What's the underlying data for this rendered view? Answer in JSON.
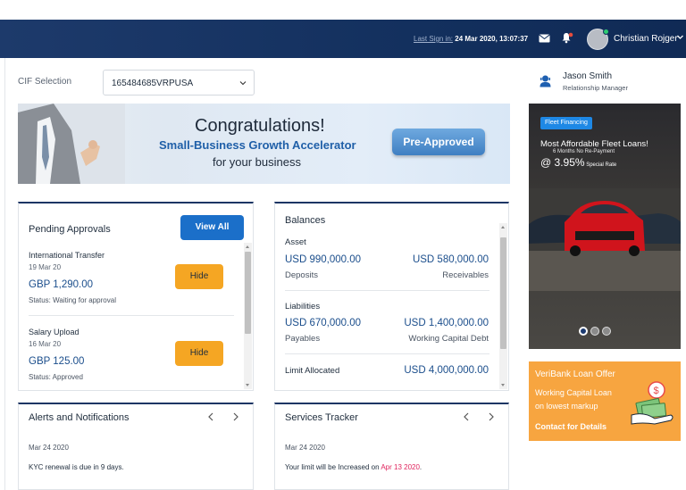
{
  "header": {
    "last_signin_label": "Last Sign in:",
    "last_signin_value": "24 Mar 2020, 13:07:37",
    "user_name": "Christian Rojger"
  },
  "cif": {
    "label": "CIF Selection",
    "selected": "165484685VRPUSA"
  },
  "banner": {
    "title": "Congratulations!",
    "subtitle": "Small-Business Growth Accelerator",
    "tagline": "for your business",
    "badge": "Pre-Approved"
  },
  "pending": {
    "title": "Pending Approvals",
    "view_all": "View All",
    "items": [
      {
        "name": "International Transfer",
        "date": "19 Mar 20",
        "amount": "GBP 1,290.00",
        "status": "Status: Waiting for approval",
        "action": "Hide"
      },
      {
        "name": "Salary Upload",
        "date": "16 Mar 20",
        "amount": "GBP 125.00",
        "status": "Status: Approved",
        "action": "Hide"
      }
    ]
  },
  "balances": {
    "title": "Balances",
    "asset": {
      "label": "Asset",
      "left_amount": "USD 990,000.00",
      "left_label": "Deposits",
      "right_amount": "USD 580,000.00",
      "right_label": "Receivables"
    },
    "liabilities": {
      "label": "Liabilities",
      "left_amount": "USD 670,000.00",
      "left_label": "Payables",
      "right_amount": "USD 1,400,000.00",
      "right_label": "Working Capital Debt"
    },
    "limit": {
      "label": "Limit Allocated",
      "amount": "USD 4,000,000.00"
    }
  },
  "alerts": {
    "title": "Alerts and Notifications",
    "date": "Mar 24 2020",
    "text": "KYC renewal is due in 9 days."
  },
  "services": {
    "title": "Services Tracker",
    "date": "Mar 24 2020",
    "text": "Your limit will be Increased on ",
    "highlight": "Apr 13 2020",
    "text_end": "."
  },
  "relationship_manager": {
    "name": "Jason Smith",
    "role": "Relationship Manager"
  },
  "ad_fleet": {
    "tag": "Fleet Financing",
    "headline": "Most Affordable Fleet Loans!",
    "sub": "6 Months No Re-Payment",
    "rate_prefix": "@ ",
    "rate": "3.95%",
    "rate_suffix": " Special Rate",
    "slides": 3,
    "active_slide": 1
  },
  "ad_loan": {
    "headline": "VeriBank Loan Offer",
    "line1": "Working Capital Loan",
    "line2": "on lowest markup",
    "cta": "Contact for Details"
  },
  "colors": {
    "header_bg": "#13305e",
    "primary_button": "#1b6fc9",
    "hide_button": "#f5a623",
    "amount_text": "#1b4e8c",
    "highlight": "#e0245e",
    "loan_ad_bg": "#f7a540"
  }
}
